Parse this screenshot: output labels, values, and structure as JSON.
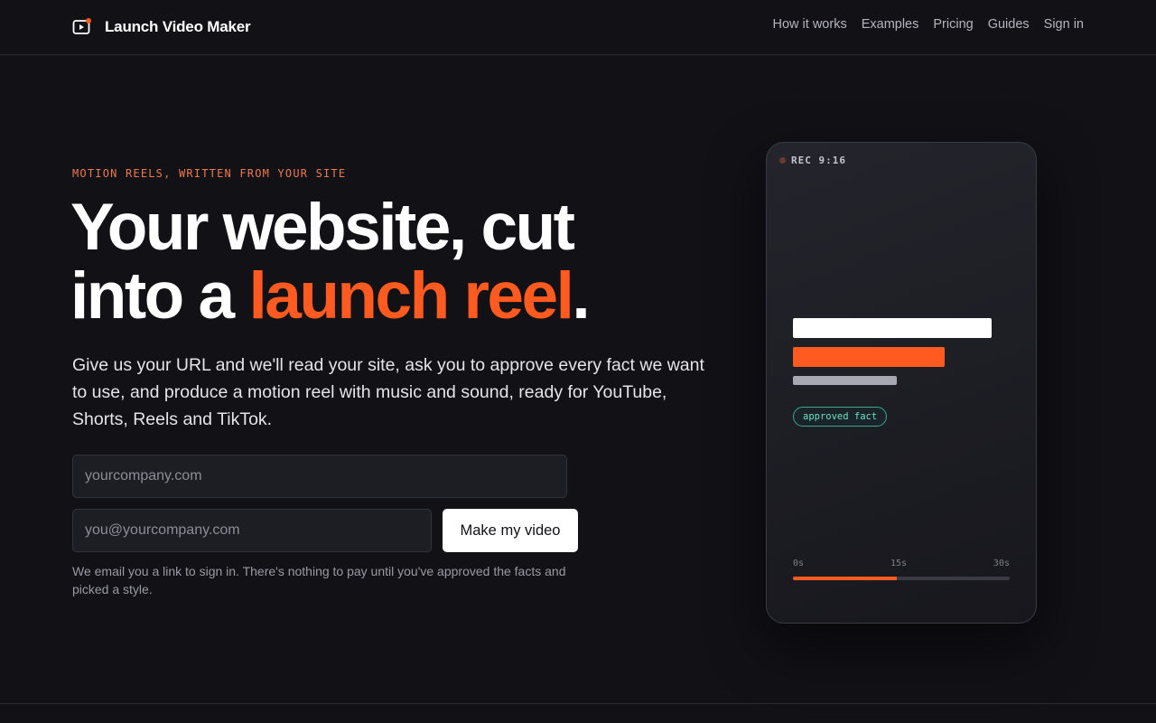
{
  "header": {
    "brand_name": "Launch Video Maker",
    "brand_icon": "play-icon",
    "nav": [
      {
        "label": "How it works"
      },
      {
        "label": "Examples"
      },
      {
        "label": "Pricing"
      },
      {
        "label": "Guides"
      },
      {
        "label": "Sign in"
      }
    ]
  },
  "hero": {
    "eyebrow": "MOTION REELS, WRITTEN FROM YOUR SITE",
    "headline_line1": "Your website, cut",
    "headline_line2_lead": "into a ",
    "headline_accent": "launch reel",
    "headline_end": ".",
    "subcopy": "Give us your URL and we'll read your site, ask you to approve every fact we want to use, and produce a motion reel with music and sound, ready for YouTube, Shorts, Reels and TikTok.",
    "url_placeholder": "yourcompany.com",
    "email_placeholder": "you@yourcompany.com",
    "cta_label": "Make my video",
    "fineprint": "We email you a link to sign in. There's nothing to pay until you've approved the facts and picked a style."
  },
  "preview": {
    "rec_label": "REC 9:16",
    "chip_label": "approved fact",
    "timeline": {
      "start": "0s",
      "mid": "15s",
      "end": "30s",
      "progress_fraction": 0.48
    }
  },
  "colors": {
    "background": "#111116",
    "accent": "#ff5a1f",
    "chip": "#6fe0c4"
  }
}
